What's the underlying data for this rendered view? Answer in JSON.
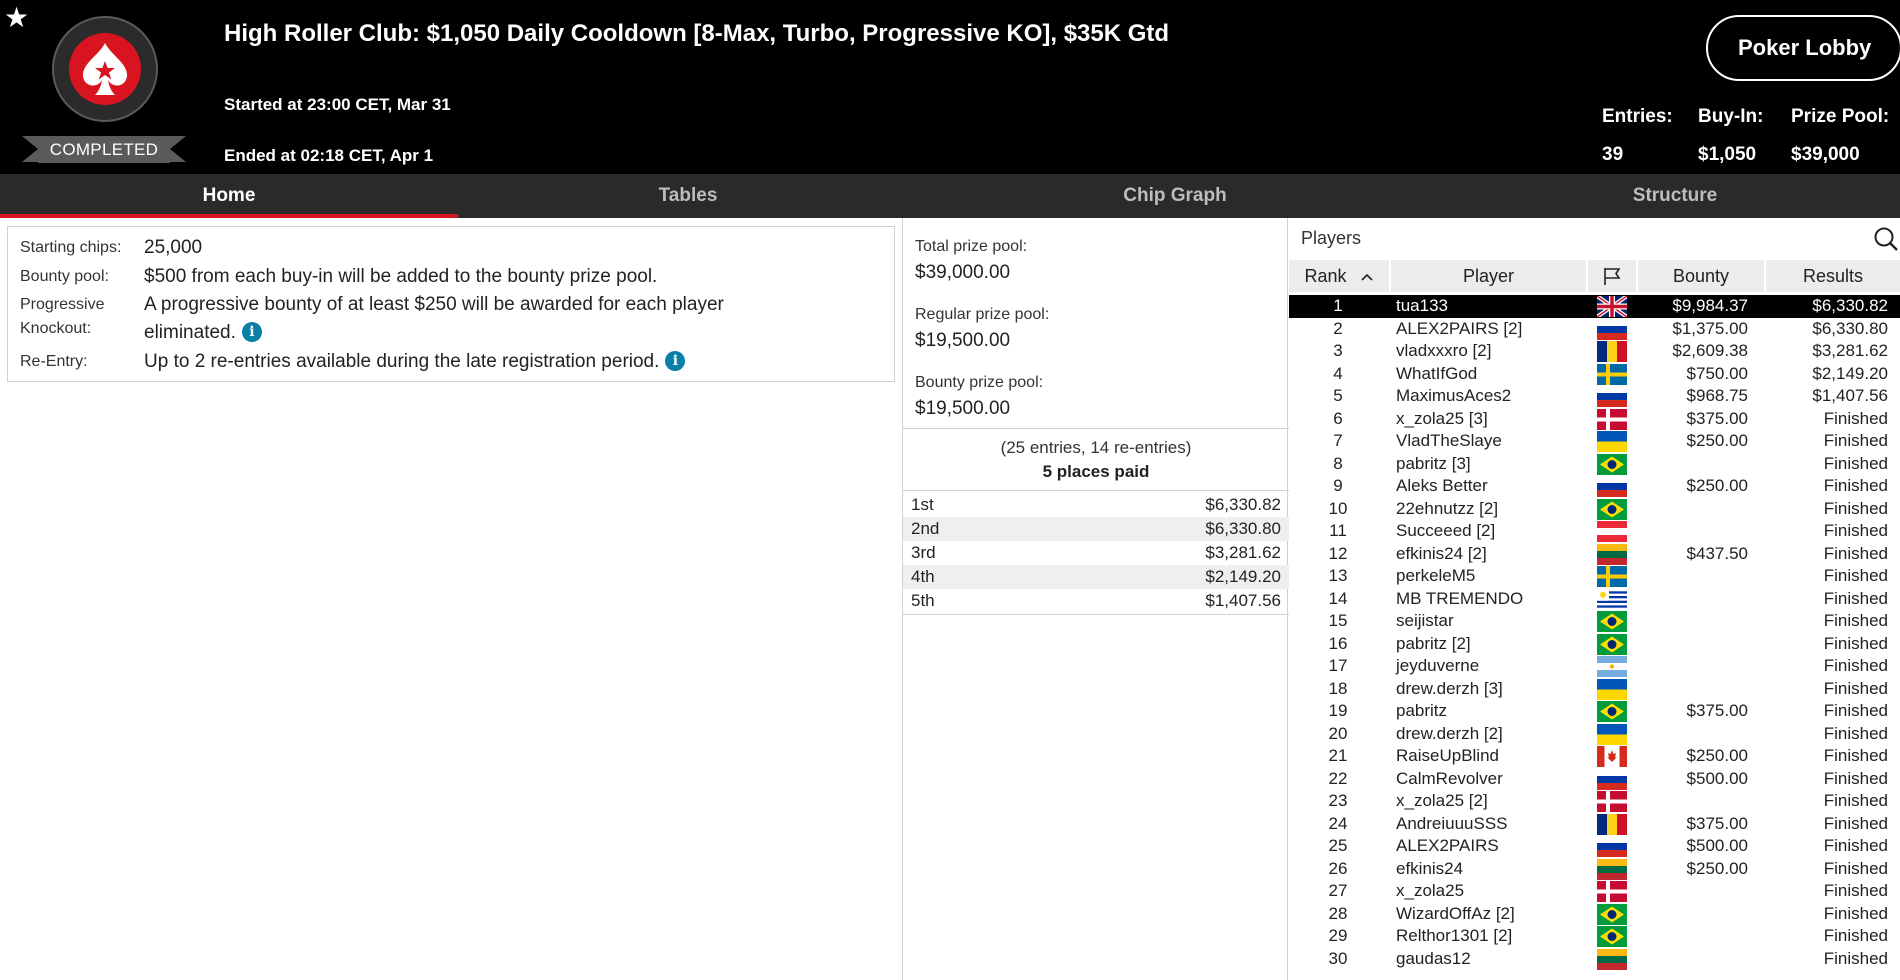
{
  "header": {
    "title": "High Roller Club: $1,050 Daily Cooldown [8-Max, Turbo, Progressive KO], $35K Gtd",
    "started": "Started at 23:00 CET, Mar 31",
    "ended": "Ended at 02:18 CET, Apr 1",
    "status": "COMPLETED",
    "favorite_icon": "star-icon",
    "logo_icon": "spade-star-logo",
    "lobby_button": "Poker Lobby",
    "stats": [
      {
        "label": "Entries:",
        "value": "39"
      },
      {
        "label": "Buy-In:",
        "value": "$1,050"
      },
      {
        "label": "Prize Pool:",
        "value": "$39,000"
      }
    ]
  },
  "tabs": [
    {
      "label": "Home",
      "active": true
    },
    {
      "label": "Tables",
      "active": false
    },
    {
      "label": "Chip Graph",
      "active": false
    },
    {
      "label": "Structure",
      "active": false
    }
  ],
  "info": {
    "starting_chips_label": "Starting chips:",
    "starting_chips_value": "25,000",
    "bounty_pool_label": "Bounty pool:",
    "bounty_pool_value": "$500 from each buy-in will be added to the bounty prize pool.",
    "progressive_label_1": "Progressive",
    "progressive_label_2": "Knockout:",
    "progressive_value_1": "A progressive bounty of at least $250 will be awarded for each player",
    "progressive_value_2": "eliminated.",
    "reentry_label": "Re-Entry:",
    "reentry_value": "Up to 2 re-entries available during the late registration period.",
    "info_glyph": "i"
  },
  "prize": {
    "total_label": "Total prize pool:",
    "total_value": "$39,000.00",
    "regular_label": "Regular prize pool:",
    "regular_value": "$19,500.00",
    "bounty_label": "Bounty prize pool:",
    "bounty_value": "$19,500.00",
    "entries_note": "(25 entries, 14 re-entries)",
    "places_paid": "5 places paid",
    "payouts": [
      {
        "place": "1st",
        "amount": "$6,330.82"
      },
      {
        "place": "2nd",
        "amount": "$6,330.80"
      },
      {
        "place": "3rd",
        "amount": "$3,281.62"
      },
      {
        "place": "4th",
        "amount": "$2,149.20"
      },
      {
        "place": "5th",
        "amount": "$1,407.56"
      }
    ]
  },
  "players": {
    "title": "Players",
    "search_icon": "search-icon",
    "columns": {
      "rank": "Rank",
      "player": "Player",
      "flag_icon": "flag-icon",
      "bounty": "Bounty",
      "results": "Results"
    },
    "sort_indicator": "^",
    "accent_color": "#d7141f",
    "rows": [
      {
        "rank": "1",
        "name": "tua133",
        "flag": "gb",
        "bounty": "$9,984.37",
        "result": "$6,330.82",
        "selected": true
      },
      {
        "rank": "2",
        "name": "ALEX2PAIRS [2]",
        "flag": "ru",
        "bounty": "$1,375.00",
        "result": "$6,330.80"
      },
      {
        "rank": "3",
        "name": "vladxxxro [2]",
        "flag": "ro",
        "bounty": "$2,609.38",
        "result": "$3,281.62"
      },
      {
        "rank": "4",
        "name": "WhatIfGod",
        "flag": "se",
        "bounty": "$750.00",
        "result": "$2,149.20"
      },
      {
        "rank": "5",
        "name": "MaximusAces2",
        "flag": "ru",
        "bounty": "$968.75",
        "result": "$1,407.56"
      },
      {
        "rank": "6",
        "name": "x_zola25 [3]",
        "flag": "dk",
        "bounty": "$375.00",
        "result": "Finished"
      },
      {
        "rank": "7",
        "name": "VladTheSlaye",
        "flag": "ua",
        "bounty": "$250.00",
        "result": "Finished"
      },
      {
        "rank": "8",
        "name": "pabritz [3]",
        "flag": "br",
        "bounty": "",
        "result": "Finished"
      },
      {
        "rank": "9",
        "name": "Aleks Better",
        "flag": "ru",
        "bounty": "$250.00",
        "result": "Finished"
      },
      {
        "rank": "10",
        "name": "22ehnutzz [2]",
        "flag": "br",
        "bounty": "",
        "result": "Finished"
      },
      {
        "rank": "11",
        "name": "Succeeed [2]",
        "flag": "at",
        "bounty": "",
        "result": "Finished"
      },
      {
        "rank": "12",
        "name": "efkinis24 [2]",
        "flag": "lt",
        "bounty": "$437.50",
        "result": "Finished"
      },
      {
        "rank": "13",
        "name": "perkeleM5",
        "flag": "se",
        "bounty": "",
        "result": "Finished"
      },
      {
        "rank": "14",
        "name": "MB TREMENDO",
        "flag": "uy",
        "bounty": "",
        "result": "Finished"
      },
      {
        "rank": "15",
        "name": "seijistar",
        "flag": "br",
        "bounty": "",
        "result": "Finished"
      },
      {
        "rank": "16",
        "name": "pabritz [2]",
        "flag": "br",
        "bounty": "",
        "result": "Finished"
      },
      {
        "rank": "17",
        "name": "jeyduverne",
        "flag": "ar",
        "bounty": "",
        "result": "Finished"
      },
      {
        "rank": "18",
        "name": "drew.derzh [3]",
        "flag": "ua",
        "bounty": "",
        "result": "Finished"
      },
      {
        "rank": "19",
        "name": "pabritz",
        "flag": "br",
        "bounty": "$375.00",
        "result": "Finished"
      },
      {
        "rank": "20",
        "name": "drew.derzh [2]",
        "flag": "ua",
        "bounty": "",
        "result": "Finished"
      },
      {
        "rank": "21",
        "name": "RaiseUpBlind",
        "flag": "ca",
        "bounty": "$250.00",
        "result": "Finished"
      },
      {
        "rank": "22",
        "name": "CalmRevolver",
        "flag": "ru",
        "bounty": "$500.00",
        "result": "Finished"
      },
      {
        "rank": "23",
        "name": "x_zola25 [2]",
        "flag": "dk",
        "bounty": "",
        "result": "Finished"
      },
      {
        "rank": "24",
        "name": "AndreiuuuSSS",
        "flag": "ro",
        "bounty": "$375.00",
        "result": "Finished"
      },
      {
        "rank": "25",
        "name": "ALEX2PAIRS",
        "flag": "ru",
        "bounty": "$500.00",
        "result": "Finished"
      },
      {
        "rank": "26",
        "name": "efkinis24",
        "flag": "lt",
        "bounty": "$250.00",
        "result": "Finished"
      },
      {
        "rank": "27",
        "name": "x_zola25",
        "flag": "dk",
        "bounty": "",
        "result": "Finished"
      },
      {
        "rank": "28",
        "name": "WizardOffAz [2]",
        "flag": "br",
        "bounty": "",
        "result": "Finished"
      },
      {
        "rank": "29",
        "name": "Relthor1301 [2]",
        "flag": "br",
        "bounty": "",
        "result": "Finished"
      },
      {
        "rank": "30",
        "name": "gaudas12",
        "flag": "lt",
        "bounty": "",
        "result": "Finished"
      }
    ]
  }
}
